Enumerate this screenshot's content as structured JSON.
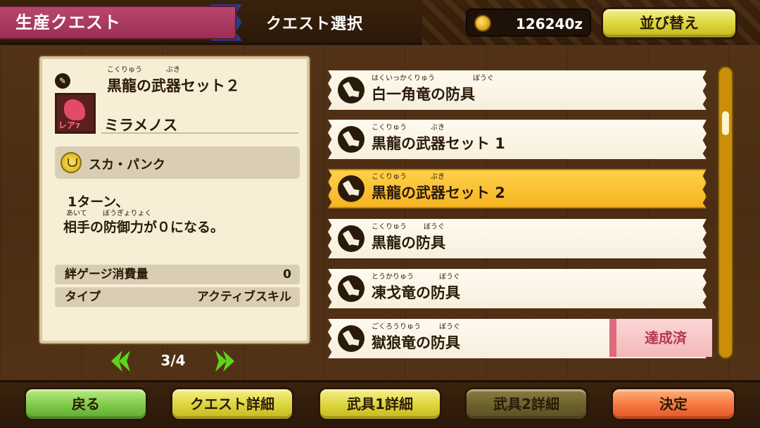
{
  "header": {
    "mode_label": "生産クエスト",
    "screen_title": "クエスト選択",
    "money": "126240z",
    "sort_label": "並び替え"
  },
  "detail": {
    "skill_ruby_1": "こくりゅう",
    "skill_ruby_2": "ぶき",
    "skill_name": "黒龍の武器セット２",
    "monster_name": "ミラメノス",
    "rarity_label": "レア",
    "rarity_value": "7",
    "kizuna_skill": "スカ・パンク",
    "desc_line1": "1ターン、",
    "desc_ruby_1": "あいて",
    "desc_ruby_2": "ぼうぎょりょく",
    "desc_line2": "相手の防御力が０になる。",
    "stats": [
      {
        "key": "絆ゲージ消費量",
        "value": "0"
      },
      {
        "key": "タイプ",
        "value": "アクティブスキル"
      }
    ]
  },
  "pager": {
    "text": "3/4"
  },
  "quests": [
    {
      "ruby1": "はくいっかくりゅう",
      "ruby2": "ぼうぐ",
      "name": "白一角竜の防具",
      "selected": false
    },
    {
      "ruby1": "こくりゅう",
      "ruby2": "ぶき",
      "name": "黒龍の武器セット 1",
      "selected": false
    },
    {
      "ruby1": "こくりゅう",
      "ruby2": "ぶき",
      "name": "黒龍の武器セット 2",
      "selected": true
    },
    {
      "ruby1": "こくりゅう",
      "ruby2": "ぼうぐ",
      "name": "黒龍の防具",
      "selected": false
    },
    {
      "ruby1": "とうかりゅう",
      "ruby2": "ぼうぐ",
      "name": "凍戈竜の防具",
      "selected": false
    },
    {
      "ruby1": "ごくろうりゅう",
      "ruby2": "ぼうぐ",
      "name": "獄狼竜の防具",
      "selected": false
    }
  ],
  "complete_badge": "達成済",
  "footer": {
    "back": "戻る",
    "quest_detail": "クエスト詳細",
    "weapon1_detail": "武具1詳細",
    "weapon2_detail": "武具2詳細",
    "confirm": "決定"
  },
  "colors": {
    "selected_item": "#f5b321",
    "mode_tab": "#9c2e55",
    "scrollbar": "#c98f0a"
  }
}
